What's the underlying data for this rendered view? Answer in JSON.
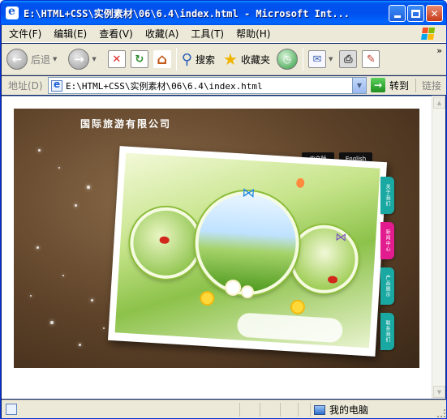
{
  "window": {
    "title": "E:\\HTML+CSS\\实例素材\\06\\6.4\\index.html - Microsoft Int..."
  },
  "menubar": {
    "items": [
      "文件(F)",
      "编辑(E)",
      "查看(V)",
      "收藏(A)",
      "工具(T)",
      "帮助(H)"
    ]
  },
  "toolbar": {
    "back_label": "后退",
    "search_label": "搜索",
    "favorites_label": "收藏夹",
    "overflow": "»"
  },
  "addressbar": {
    "label": "地址(D)",
    "url": "E:\\HTML+CSS\\实例素材\\06\\6.4\\index.html",
    "go_label": "转到",
    "links_label": "链接"
  },
  "site": {
    "title": "国际旅游有限公司",
    "lang_cn": "中文版",
    "lang_en": "English",
    "tabs": [
      "关于我们",
      "新闻中心",
      "产品展示",
      "联系我们"
    ]
  },
  "statusbar": {
    "zone_label": "我的电脑"
  },
  "colors": {
    "titlebar": "#0053ee",
    "chrome": "#ece9d8",
    "tab_teal": "#1aa9a2",
    "tab_magenta": "#e21c8f",
    "site_brown": "#5c4128"
  }
}
